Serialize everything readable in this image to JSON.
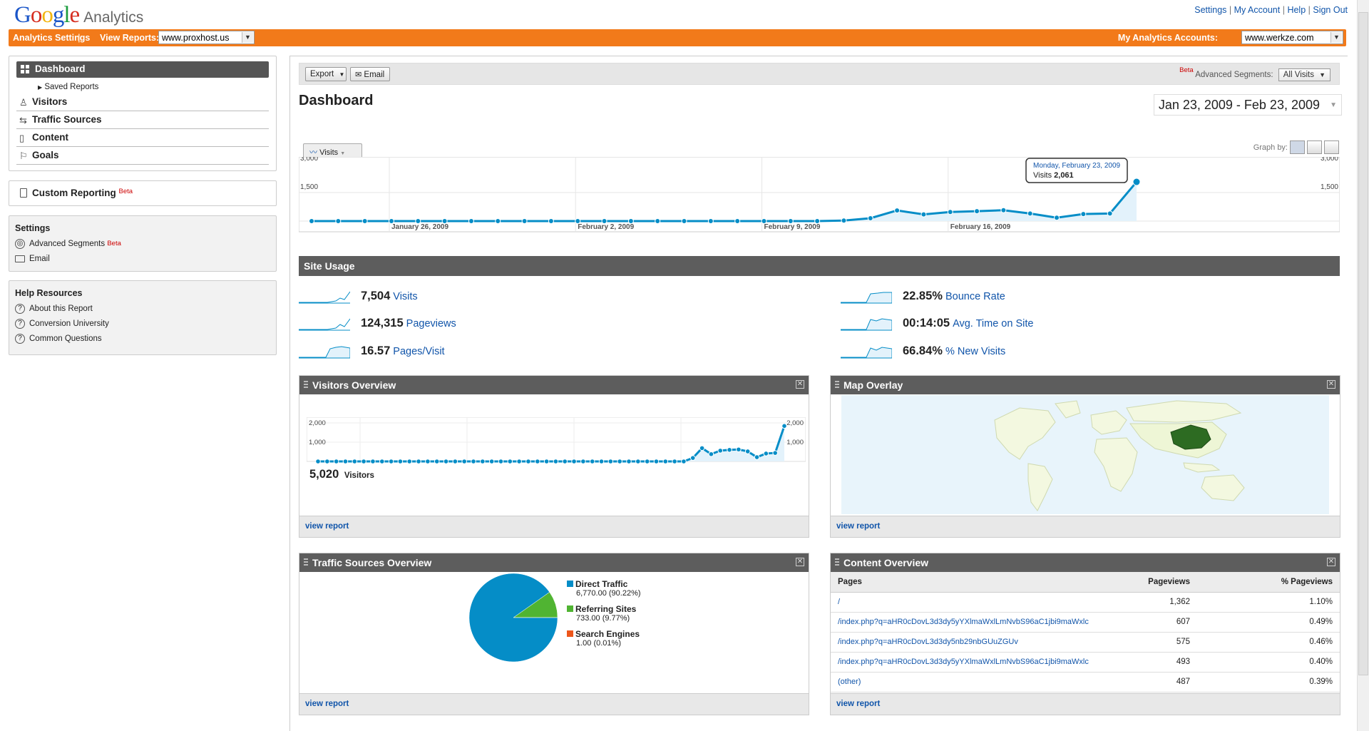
{
  "header": {
    "logo_google": "Google",
    "logo_analytics": "Analytics",
    "links": [
      "Settings",
      "My Account",
      "Help",
      "Sign Out"
    ]
  },
  "orangebar": {
    "settings_label": "Analytics Settings",
    "view_reports_label": "View Reports:",
    "site_value": "www.proxhost.us",
    "accounts_label": "My Analytics Accounts:",
    "account_value": "www.werkze.com"
  },
  "sidebar": {
    "dashboard": "Dashboard",
    "saved_reports": "Saved Reports",
    "nav": [
      "Visitors",
      "Traffic Sources",
      "Content",
      "Goals"
    ],
    "custom_reporting": "Custom Reporting",
    "beta": "Beta",
    "settings_title": "Settings",
    "settings_items": [
      "Advanced Segments",
      "Email"
    ],
    "help_title": "Help Resources",
    "help_items": [
      "About this Report",
      "Conversion University",
      "Common Questions"
    ]
  },
  "toolbar": {
    "export": "Export",
    "email": "Email",
    "beta": "Beta",
    "advanced_segments": "Advanced Segments:",
    "segment_value": "All Visits"
  },
  "page_title": "Dashboard",
  "date_range": "Jan 23, 2009 - Feb 23, 2009",
  "graph": {
    "tab": "Visits",
    "graph_by": "Graph by:",
    "tooltip_date": "Monday, February 23, 2009",
    "tooltip_label": "Visits",
    "tooltip_value": "2,061"
  },
  "chart_data": [
    {
      "type": "area",
      "title": "Visits",
      "ylim": [
        0,
        3000
      ],
      "yticks": [
        "3,000",
        "1,500"
      ],
      "yticks_right": [
        "3,000",
        "1,500"
      ],
      "xticks": [
        "January 26, 2009",
        "February 2, 2009",
        "February 9, 2009",
        "February 16, 2009"
      ],
      "x": [
        "Jan 23",
        "Jan 24",
        "Jan 25",
        "Jan 26",
        "Jan 27",
        "Jan 28",
        "Jan 29",
        "Jan 30",
        "Jan 31",
        "Feb 1",
        "Feb 2",
        "Feb 3",
        "Feb 4",
        "Feb 5",
        "Feb 6",
        "Feb 7",
        "Feb 8",
        "Feb 9",
        "Feb 10",
        "Feb 11",
        "Feb 12",
        "Feb 13",
        "Feb 14",
        "Feb 15",
        "Feb 16",
        "Feb 17",
        "Feb 18",
        "Feb 19",
        "Feb 20",
        "Feb 21",
        "Feb 22",
        "Feb 23"
      ],
      "values": [
        0,
        0,
        0,
        0,
        0,
        0,
        0,
        0,
        0,
        0,
        0,
        0,
        0,
        0,
        0,
        0,
        0,
        0,
        0,
        0,
        30,
        150,
        560,
        350,
        480,
        520,
        570,
        400,
        180,
        370,
        400,
        2061
      ],
      "grid": true
    },
    {
      "type": "area",
      "title": "Visitors Overview",
      "ylim": [
        0,
        2000
      ],
      "yticks": [
        "2,000",
        "1,000"
      ],
      "yticks_right": [
        "2,000",
        "1,000"
      ],
      "values": [
        0,
        0,
        0,
        0,
        0,
        0,
        0,
        0,
        0,
        0,
        0,
        0,
        0,
        0,
        0,
        0,
        0,
        0,
        0,
        0,
        0,
        0,
        0,
        0,
        0,
        0,
        0,
        0,
        0,
        0,
        0,
        0,
        0,
        0,
        0,
        0,
        0,
        0,
        0,
        0,
        0,
        180,
        690,
        380,
        560,
        600,
        620,
        520,
        220,
        410,
        440,
        1840
      ],
      "grid": true
    },
    {
      "type": "pie",
      "title": "Traffic Sources Overview",
      "labels": [
        "Direct Traffic",
        "Referring Sites",
        "Search Engines"
      ],
      "values": [
        6770.0,
        733.0,
        1.0
      ],
      "percents": [
        "90.22%",
        "9.77%",
        "0.01%"
      ],
      "details": [
        "6,770.00 (90.22%)",
        "733.00 (9.77%)",
        "1.00 (0.01%)"
      ],
      "colors": [
        "#058dc7",
        "#50b432",
        "#ed561b"
      ]
    }
  ],
  "site_usage": {
    "title": "Site Usage",
    "metrics": [
      {
        "value": "7,504",
        "name": "Visits"
      },
      {
        "value": "124,315",
        "name": "Pageviews"
      },
      {
        "value": "16.57",
        "name": "Pages/Visit"
      },
      {
        "value": "22.85%",
        "name": "Bounce Rate"
      },
      {
        "value": "00:14:05",
        "name": "Avg. Time on Site"
      },
      {
        "value": "66.84%",
        "name": "% New Visits"
      }
    ]
  },
  "panels": {
    "visitors_overview": {
      "title": "Visitors Overview",
      "total": "5,020",
      "total_label": "Visitors",
      "view_report": "view report"
    },
    "map_overlay": {
      "title": "Map Overlay",
      "view_report": "view report"
    },
    "traffic_sources": {
      "title": "Traffic Sources Overview",
      "view_report": "view report"
    },
    "content_overview": {
      "title": "Content Overview",
      "columns": [
        "Pages",
        "Pageviews",
        "% Pageviews"
      ],
      "rows": [
        {
          "page": "/",
          "pageviews": "1,362",
          "pct": "1.10%"
        },
        {
          "page": "/index.php?q=aHR0cDovL3d3dy5yYXlmaWxlLmNvbS96aC1jbi9maWxlc",
          "pageviews": "607",
          "pct": "0.49%"
        },
        {
          "page": "/index.php?q=aHR0cDovL3d3dy5nb29nbGUuZGUv",
          "pageviews": "575",
          "pct": "0.46%"
        },
        {
          "page": "/index.php?q=aHR0cDovL3d3dy5yYXlmaWxlLmNvbS96aC1jbi9maWxlc",
          "pageviews": "493",
          "pct": "0.40%"
        },
        {
          "page": "(other)",
          "pageviews": "487",
          "pct": "0.39%"
        }
      ],
      "view_report": "view report"
    }
  }
}
